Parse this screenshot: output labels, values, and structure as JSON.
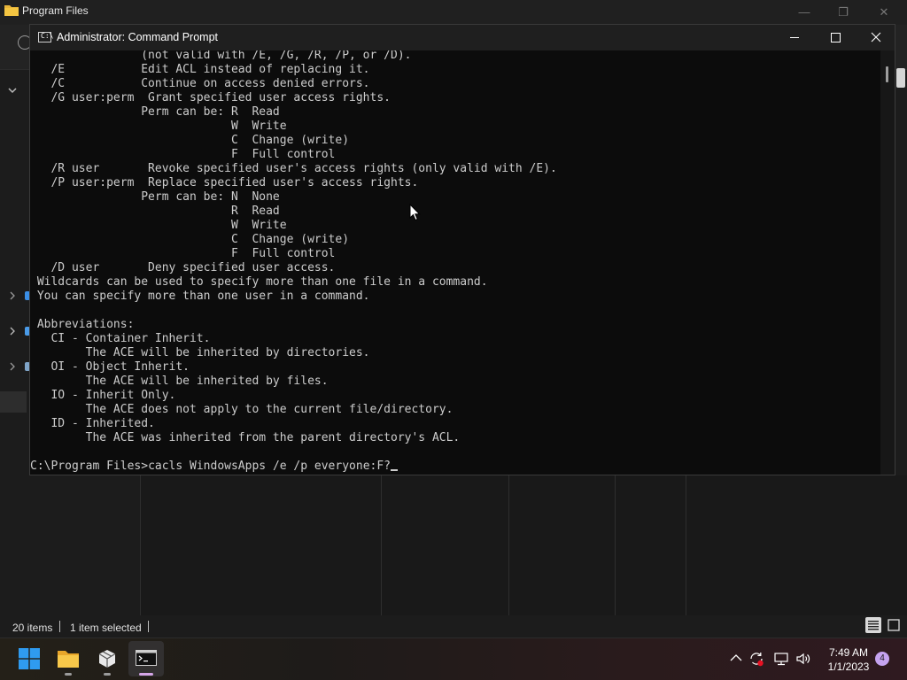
{
  "explorer": {
    "title": "Program Files",
    "status": {
      "item_count": "20 items",
      "selected": "1 item selected"
    }
  },
  "cmd": {
    "title": "Administrator: Command Prompt",
    "icon_label": "C:\\",
    "lines": [
      "                (not valid with /E, /G, /R, /P, or /D).",
      "   /E           Edit ACL instead of replacing it.",
      "   /C           Continue on access denied errors.",
      "   /G user:perm  Grant specified user access rights.",
      "                Perm can be: R  Read",
      "                             W  Write",
      "                             C  Change (write)",
      "                             F  Full control",
      "   /R user       Revoke specified user's access rights (only valid with /E).",
      "   /P user:perm  Replace specified user's access rights.",
      "                Perm can be: N  None",
      "                             R  Read",
      "                             W  Write",
      "                             C  Change (write)",
      "                             F  Full control",
      "   /D user       Deny specified user access.",
      " Wildcards can be used to specify more than one file in a command.",
      " You can specify more than one user in a command.",
      "",
      " Abbreviations:",
      "   CI - Container Inherit.",
      "        The ACE will be inherited by directories.",
      "   OI - Object Inherit.",
      "        The ACE will be inherited by files.",
      "   IO - Inherit Only.",
      "        The ACE does not apply to the current file/directory.",
      "   ID - Inherited.",
      "        The ACE was inherited from the parent directory's ACL.",
      ""
    ],
    "prompt": "C:\\Program Files>",
    "command": "cacls WindowsApps /e /p everyone:F?"
  },
  "taskbar": {
    "time": "7:49 AM",
    "date": "1/1/2023",
    "notification_count": "4",
    "icons": [
      "windows-start-icon",
      "file-explorer-icon",
      "package-icon",
      "terminal-icon"
    ]
  },
  "colors": {
    "console_text": "#cccccc",
    "console_bg": "#0c0c0c",
    "accent_start": "#2f9bf0",
    "notification_badge": "#c5a3f0",
    "folder": "#f4c542"
  }
}
